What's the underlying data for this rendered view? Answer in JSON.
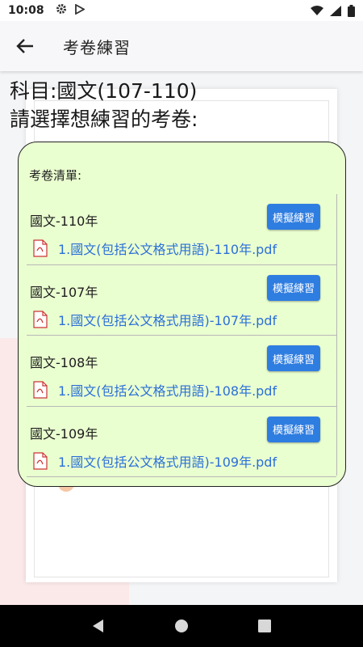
{
  "status_bar": {
    "time": "10:08"
  },
  "app_bar": {
    "title": "考卷練習"
  },
  "subject": "科目:國文(107-110)",
  "prompt": "請選擇想練習的考卷:",
  "list": {
    "header": "考卷清單:",
    "items": [
      {
        "year": "國文-110年",
        "button": "模擬練習",
        "file": "1.國文(包括公文格式用語)-110年.pdf"
      },
      {
        "year": "國文-107年",
        "button": "模擬練習",
        "file": "1.國文(包括公文格式用語)-107年.pdf"
      },
      {
        "year": "國文-108年",
        "button": "模擬練習",
        "file": "1.國文(包括公文格式用語)-108年.pdf"
      },
      {
        "year": "國文-109年",
        "button": "模擬練習",
        "file": "1.國文(包括公文格式用語)-109年.pdf"
      }
    ]
  },
  "colors": {
    "card_bg": "#eaffd0",
    "button": "#2e7de1",
    "link": "#2a6fd8"
  },
  "icons": [
    "gear-icon",
    "play-store-icon",
    "wifi-icon",
    "signal-icon",
    "battery-icon",
    "back-arrow-icon",
    "pdf-icon",
    "nav-back-icon",
    "nav-home-icon",
    "nav-recents-icon"
  ]
}
